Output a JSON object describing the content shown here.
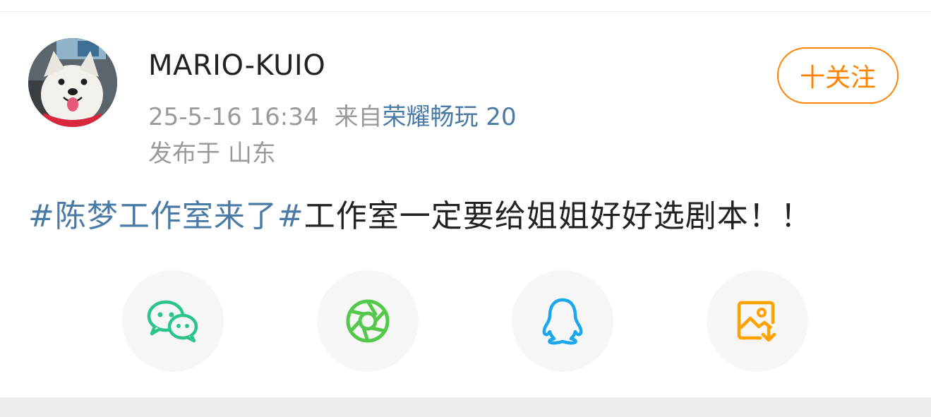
{
  "post": {
    "author": {
      "name": "MARIO-KUIO",
      "avatar_icon": "samoyed-dog-avatar"
    },
    "timestamp": "25-5-16 16:34",
    "source_prefix": "来自",
    "source_device": "荣耀畅玩 20",
    "location_prefix": "发布于",
    "location": "山东",
    "follow_label": "十关注",
    "text": {
      "topic": "#陈梦工作室来了#",
      "body": "工作室一定要给姐姐好好选剧本！！"
    }
  },
  "share": {
    "items": [
      {
        "name": "wechat",
        "icon": "wechat-icon",
        "color": "#2bc48a"
      },
      {
        "name": "moments",
        "icon": "moments-icon",
        "color": "#52c94a"
      },
      {
        "name": "qq",
        "icon": "qq-icon",
        "color": "#1aa7ec"
      },
      {
        "name": "save-image",
        "icon": "save-image-icon",
        "color": "#ffa200"
      }
    ]
  },
  "colors": {
    "accent_orange": "#ff8200",
    "link_blue": "#4a7aa6",
    "meta_gray": "#9a9a9a"
  }
}
